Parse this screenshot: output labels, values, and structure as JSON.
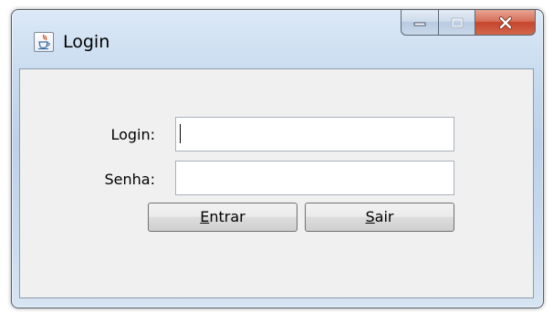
{
  "window": {
    "title": "Login",
    "icon": "java-cup-icon"
  },
  "form": {
    "login_label": "Login:",
    "login_value": "",
    "password_label": "Senha:",
    "password_value": ""
  },
  "buttons": {
    "enter": {
      "mnemonic": "E",
      "rest": "ntrar"
    },
    "exit": {
      "mnemonic": "S",
      "rest": "air"
    }
  },
  "colors": {
    "close_button": "#c5452d",
    "client_background": "#f0f0f0"
  }
}
